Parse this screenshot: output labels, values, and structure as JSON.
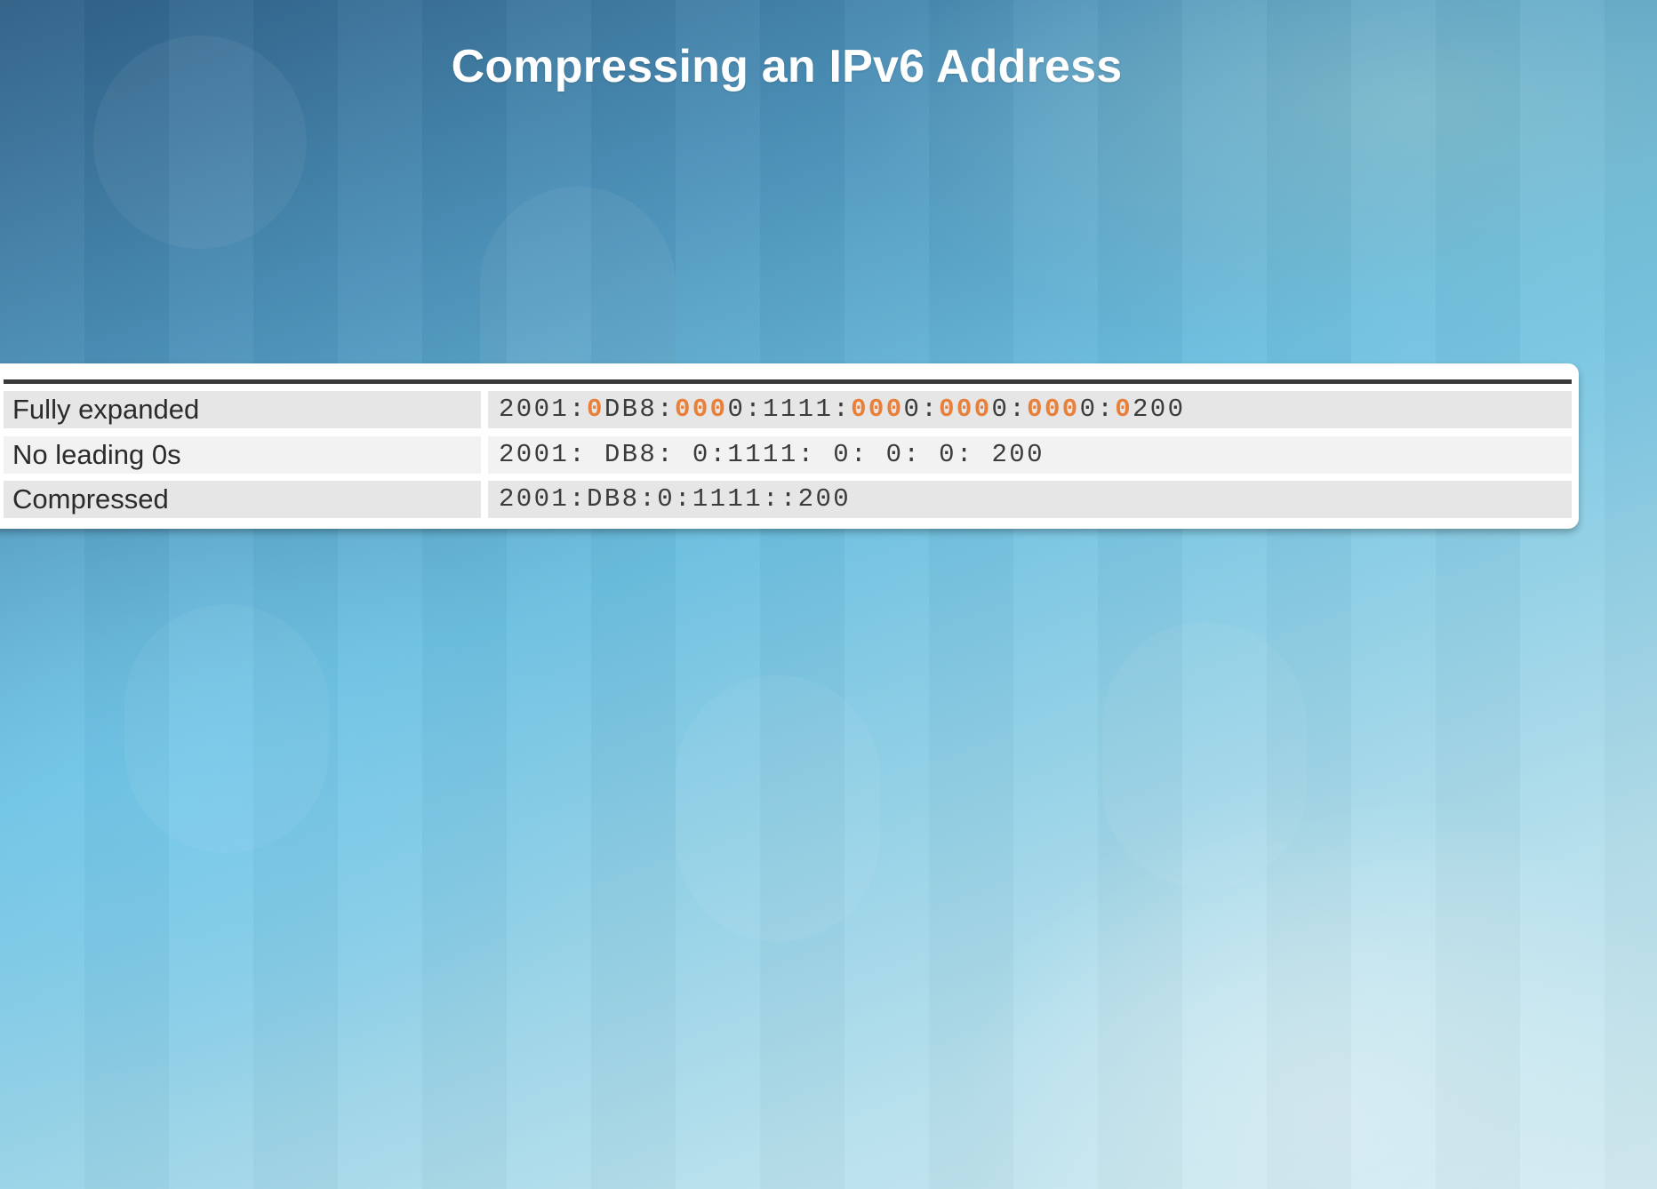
{
  "title": "Compressing an IPv6 Address",
  "colors": {
    "highlight": "#e8803a",
    "text": "#2b2b2b",
    "rule": "#3a3a3a"
  },
  "rows": [
    {
      "label": "Fully expanded",
      "segments": [
        {
          "text": "2001:",
          "highlight": false
        },
        {
          "text": "0",
          "highlight": true
        },
        {
          "text": "DB8:",
          "highlight": false
        },
        {
          "text": "000",
          "highlight": true
        },
        {
          "text": "0:1111:",
          "highlight": false
        },
        {
          "text": "000",
          "highlight": true
        },
        {
          "text": "0:",
          "highlight": false
        },
        {
          "text": "000",
          "highlight": true
        },
        {
          "text": "0:",
          "highlight": false
        },
        {
          "text": "000",
          "highlight": true
        },
        {
          "text": "0:",
          "highlight": false
        },
        {
          "text": "0",
          "highlight": true
        },
        {
          "text": "200",
          "highlight": false
        }
      ]
    },
    {
      "label": "No leading 0s",
      "segments": [
        {
          "text": "2001: DB8: 0:1111: 0: 0: 0: 200",
          "highlight": false
        }
      ]
    },
    {
      "label": "Compressed",
      "segments": [
        {
          "text": "2001:DB8:0:1111::200",
          "highlight": false
        }
      ]
    }
  ]
}
